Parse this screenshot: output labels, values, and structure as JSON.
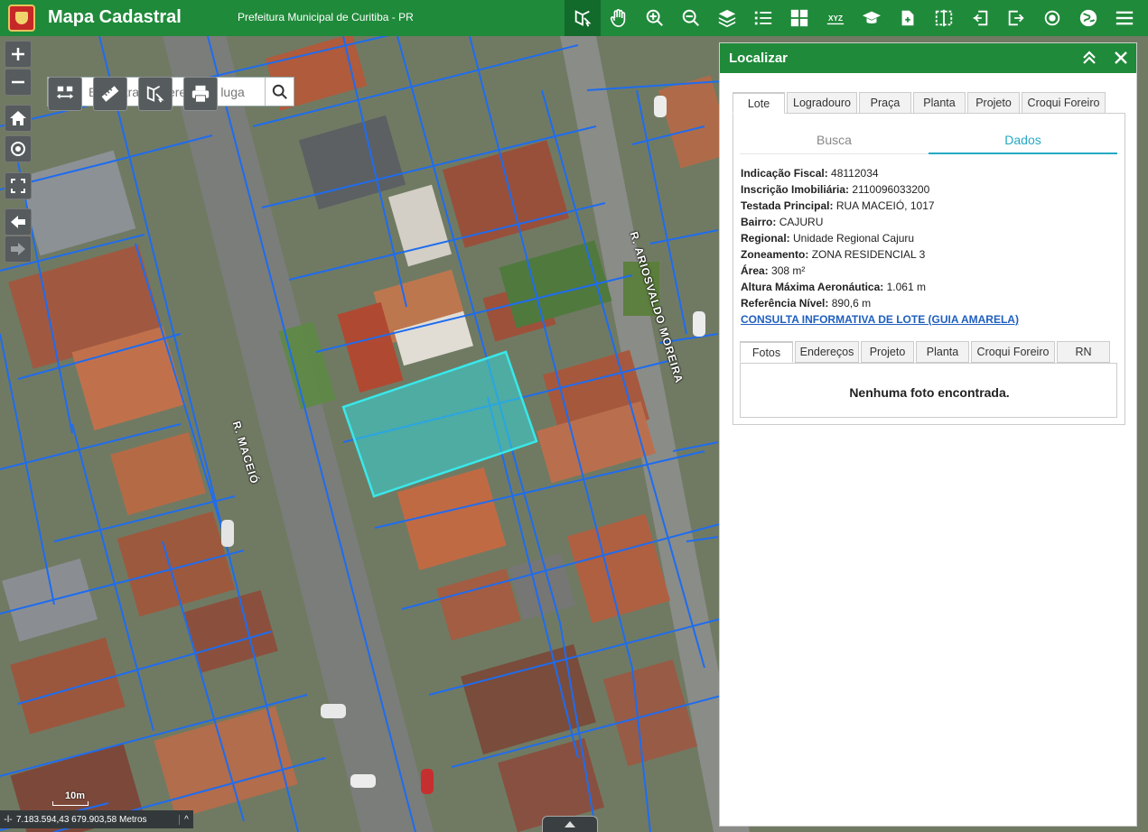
{
  "header": {
    "title": "Mapa Cadastral",
    "subtitle": "Prefeitura Municipal de Curitiba - PR",
    "toolbar": [
      {
        "icon": "identify-icon",
        "active": true
      },
      {
        "icon": "pan-hand-icon"
      },
      {
        "icon": "zoom-in-icon"
      },
      {
        "icon": "zoom-out-icon"
      },
      {
        "icon": "layers-icon"
      },
      {
        "icon": "legend-list-icon"
      },
      {
        "icon": "grid-icon"
      },
      {
        "icon": "xyz-icon",
        "text": "XYZ"
      },
      {
        "icon": "graduation-cap-icon"
      },
      {
        "icon": "add-document-icon"
      },
      {
        "icon": "compare-icon"
      },
      {
        "icon": "login-icon"
      },
      {
        "icon": "logout-icon"
      },
      {
        "icon": "target-icon"
      },
      {
        "icon": "globe-icon"
      },
      {
        "icon": "menu-icon"
      }
    ]
  },
  "search": {
    "placeholder": "Encontrar endereço ou luga"
  },
  "map": {
    "streets": {
      "main": "R. MACEIÓ",
      "secondary": "R. ARIOSVALDO MOREIRA"
    },
    "scale": "10m",
    "coordinates": "7.183.594,43 679.903,58 Metros",
    "colors": {
      "lot_border": "#1e6cf0",
      "selected_fill": "#33d6d9",
      "selected_border": "#39e8ea"
    }
  },
  "panel": {
    "title": "Localizar",
    "tabs": [
      "Lote",
      "Logradouro",
      "Praça",
      "Planta",
      "Projeto",
      "Croqui Foreiro"
    ],
    "active_tab": "Lote",
    "subtabs": [
      "Busca",
      "Dados"
    ],
    "active_subtab": "Dados",
    "details": [
      {
        "label": "Indicação Fiscal:",
        "value": "48112034"
      },
      {
        "label": "Inscrição Imobiliária:",
        "value": "2110096033200"
      },
      {
        "label": "Testada Principal:",
        "value": "RUA MACEIÓ, 1017"
      },
      {
        "label": "Bairro:",
        "value": "CAJURU"
      },
      {
        "label": "Regional:",
        "value": "Unidade Regional Cajuru"
      },
      {
        "label": "Zoneamento:",
        "value": "ZONA RESIDENCIAL 3"
      },
      {
        "label": "Área:",
        "value": "308 m²"
      },
      {
        "label": "Altura Máxima Aeronáutica:",
        "value": "1.061 m"
      },
      {
        "label": "Referência Nível:",
        "value": "890,6 m"
      }
    ],
    "link": "CONSULTA INFORMATIVA DE LOTE (GUIA AMARELA)",
    "photo_tabs": [
      "Fotos",
      "Endereços",
      "Projeto",
      "Planta",
      "Croqui Foreiro",
      "RN"
    ],
    "active_photo_tab": "Fotos",
    "no_photo": "Nenhuma foto encontrada."
  }
}
